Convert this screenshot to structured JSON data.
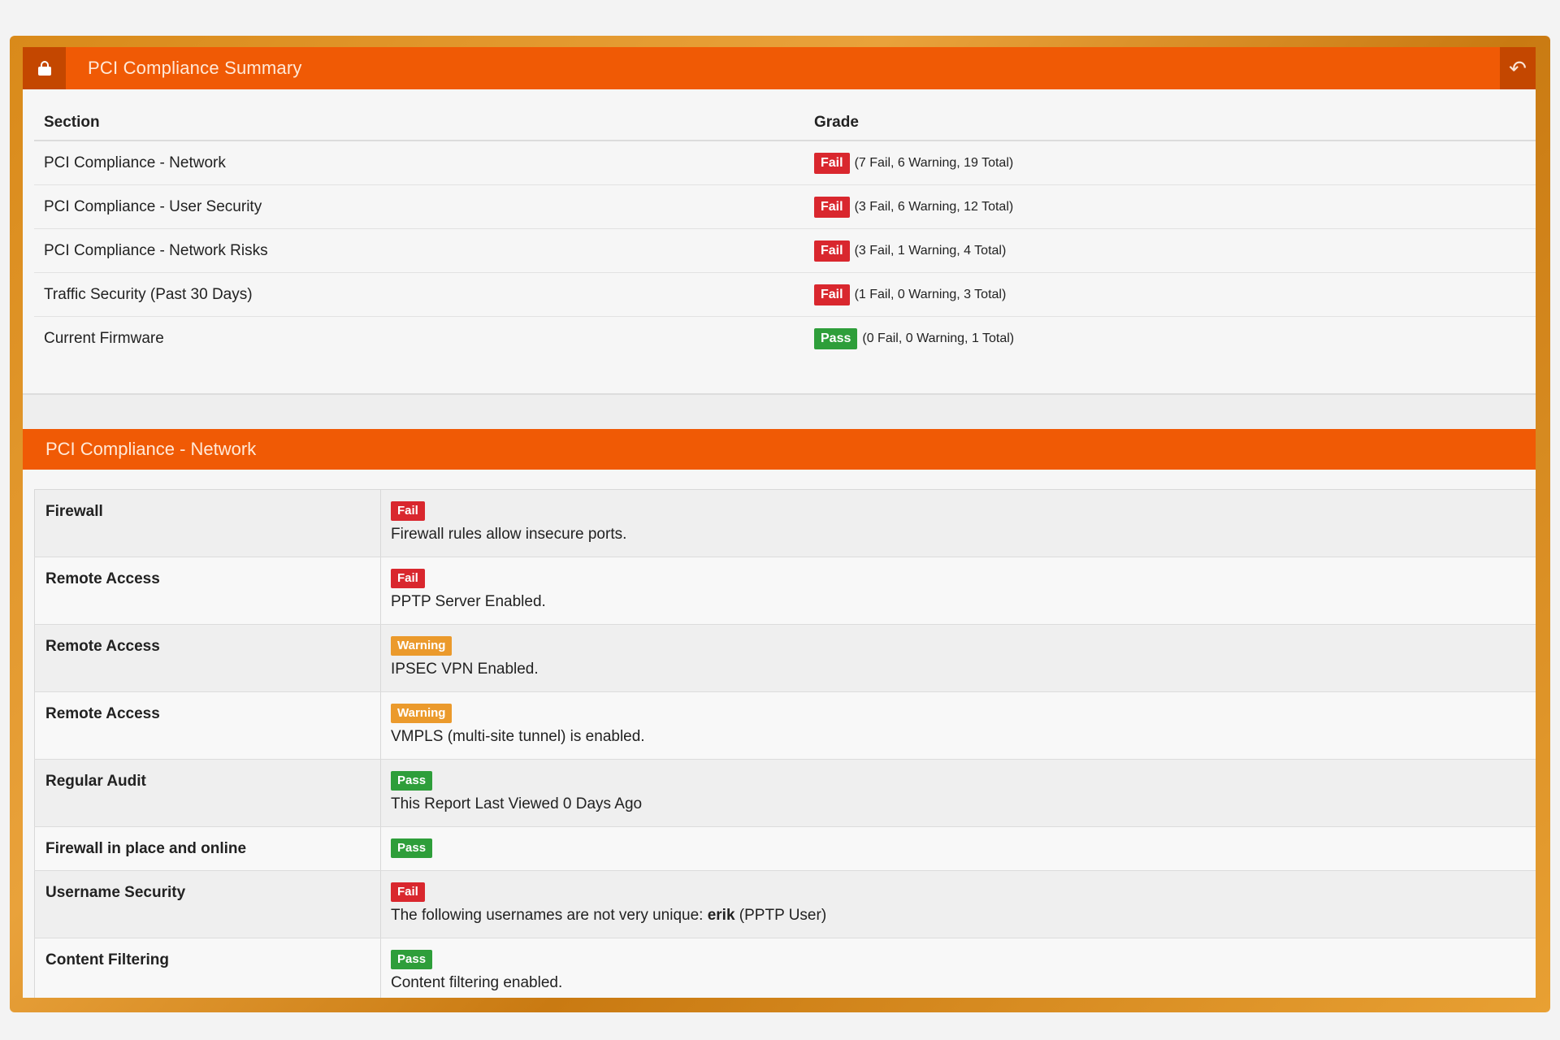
{
  "header": {
    "title": "PCI Compliance Summary"
  },
  "summary": {
    "col_section": "Section",
    "col_grade": "Grade",
    "rows": [
      {
        "section": "PCI Compliance - Network",
        "status": "Fail",
        "counts": "(7 Fail, 6 Warning, 19 Total)"
      },
      {
        "section": "PCI Compliance - User Security",
        "status": "Fail",
        "counts": "(3 Fail, 6 Warning, 12 Total)"
      },
      {
        "section": "PCI Compliance - Network Risks",
        "status": "Fail",
        "counts": "(3 Fail, 1 Warning, 4 Total)"
      },
      {
        "section": "Traffic Security (Past 30 Days)",
        "status": "Fail",
        "counts": "(1 Fail, 0 Warning, 3 Total)"
      },
      {
        "section": "Current Firmware",
        "status": "Pass",
        "counts": "(0 Fail, 0 Warning, 1 Total)"
      }
    ]
  },
  "network_section": {
    "title": "PCI Compliance - Network",
    "rows": [
      {
        "label": "Firewall",
        "status": "Fail",
        "message": "Firewall rules allow insecure ports."
      },
      {
        "label": "Remote Access",
        "status": "Fail",
        "message": "PPTP Server Enabled."
      },
      {
        "label": "Remote Access",
        "status": "Warning",
        "message": "IPSEC VPN Enabled."
      },
      {
        "label": "Remote Access",
        "status": "Warning",
        "message": "VMPLS (multi-site tunnel) is enabled."
      },
      {
        "label": "Regular Audit",
        "status": "Pass",
        "message": "This Report Last Viewed 0 Days Ago"
      },
      {
        "label": "Firewall in place and online",
        "status": "Pass",
        "message": ""
      },
      {
        "label": "Username Security",
        "status": "Fail",
        "message_prefix": "The following usernames are not very unique: ",
        "message_bold": "erik",
        "message_suffix": " (PPTP User)"
      },
      {
        "label": "Content Filtering",
        "status": "Pass",
        "message": "Content filtering enabled."
      }
    ]
  },
  "colors": {
    "accent": "#f05a05",
    "accent_dark": "#c44700",
    "fail": "#d9272e",
    "pass": "#2e9e3a",
    "warning": "#eb9a2c"
  },
  "icons": {
    "header": "lock-icon",
    "back": "back-arrow-icon"
  }
}
